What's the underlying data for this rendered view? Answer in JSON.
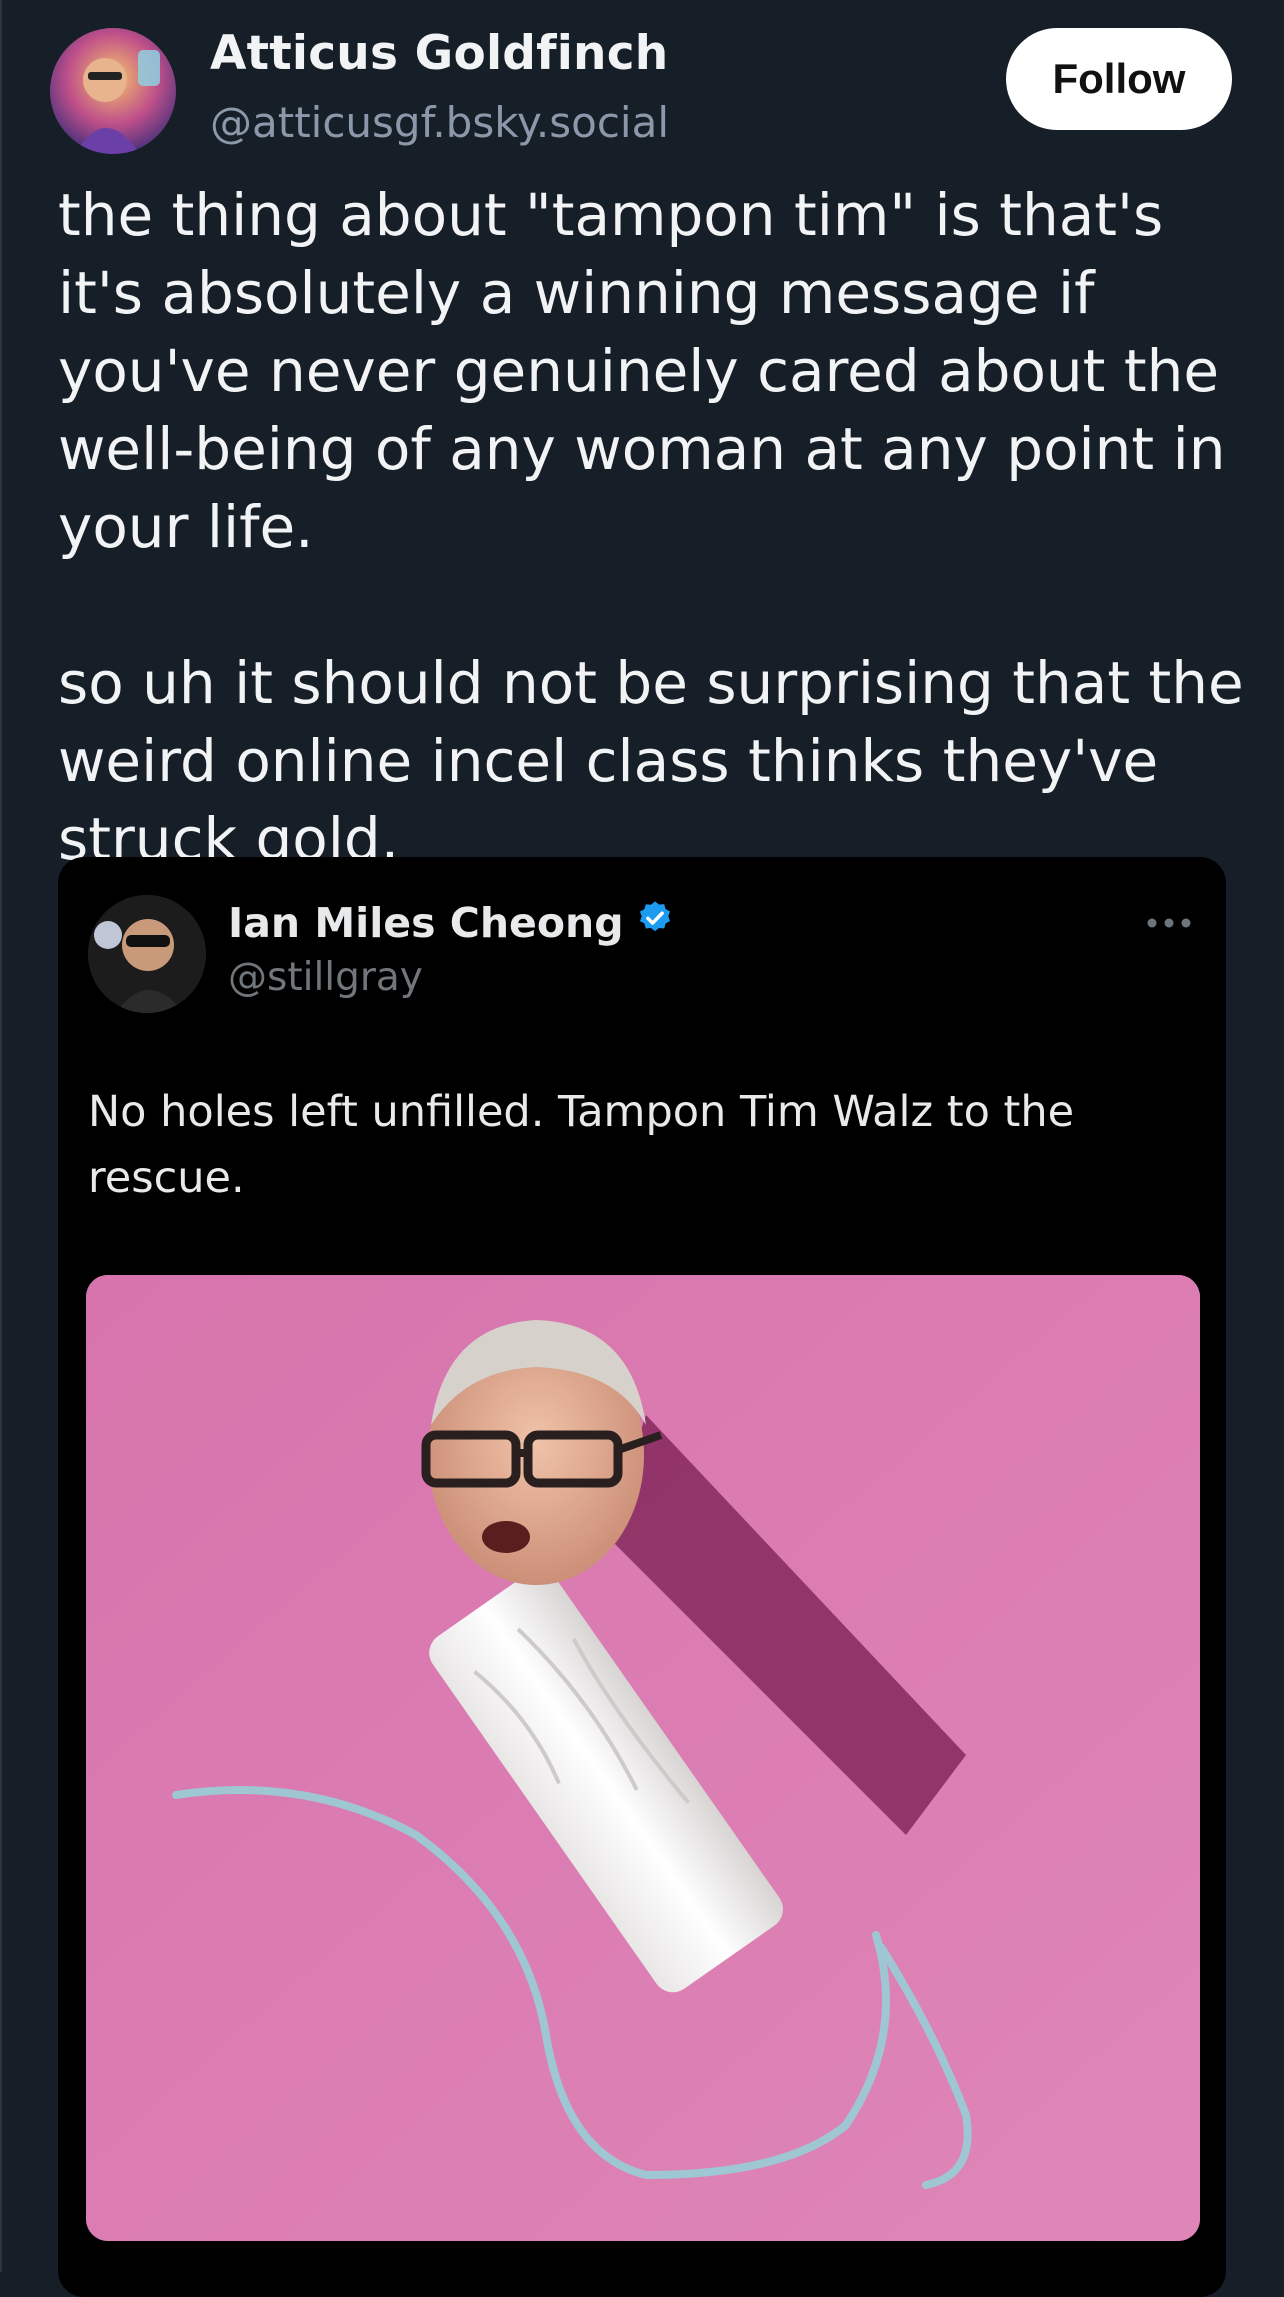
{
  "post": {
    "author_name": "Atticus Goldfinch",
    "author_handle": "@atticusgf.bsky.social",
    "follow_label": "Follow",
    "paragraphs": [
      "the thing about \"tampon tim\" is that's it's absolutely a winning message if you've never genuinely cared about the well-being of any woman at any point in your life.",
      "so uh it should not be surprising that the weird online incel class thinks they've struck gold."
    ]
  },
  "quoted": {
    "author_name": "Ian Miles Cheong",
    "author_handle": "@stillgray",
    "verified": true,
    "text": "No holes left unfilled. Tampon Tim Walz to the rescue."
  },
  "colors": {
    "background": "#161e27",
    "card_background": "#000000",
    "verified_badge": "#1d9bf0",
    "image_background": "#d97bb0"
  },
  "icons": [
    "verified-badge-icon",
    "more-options-icon"
  ]
}
